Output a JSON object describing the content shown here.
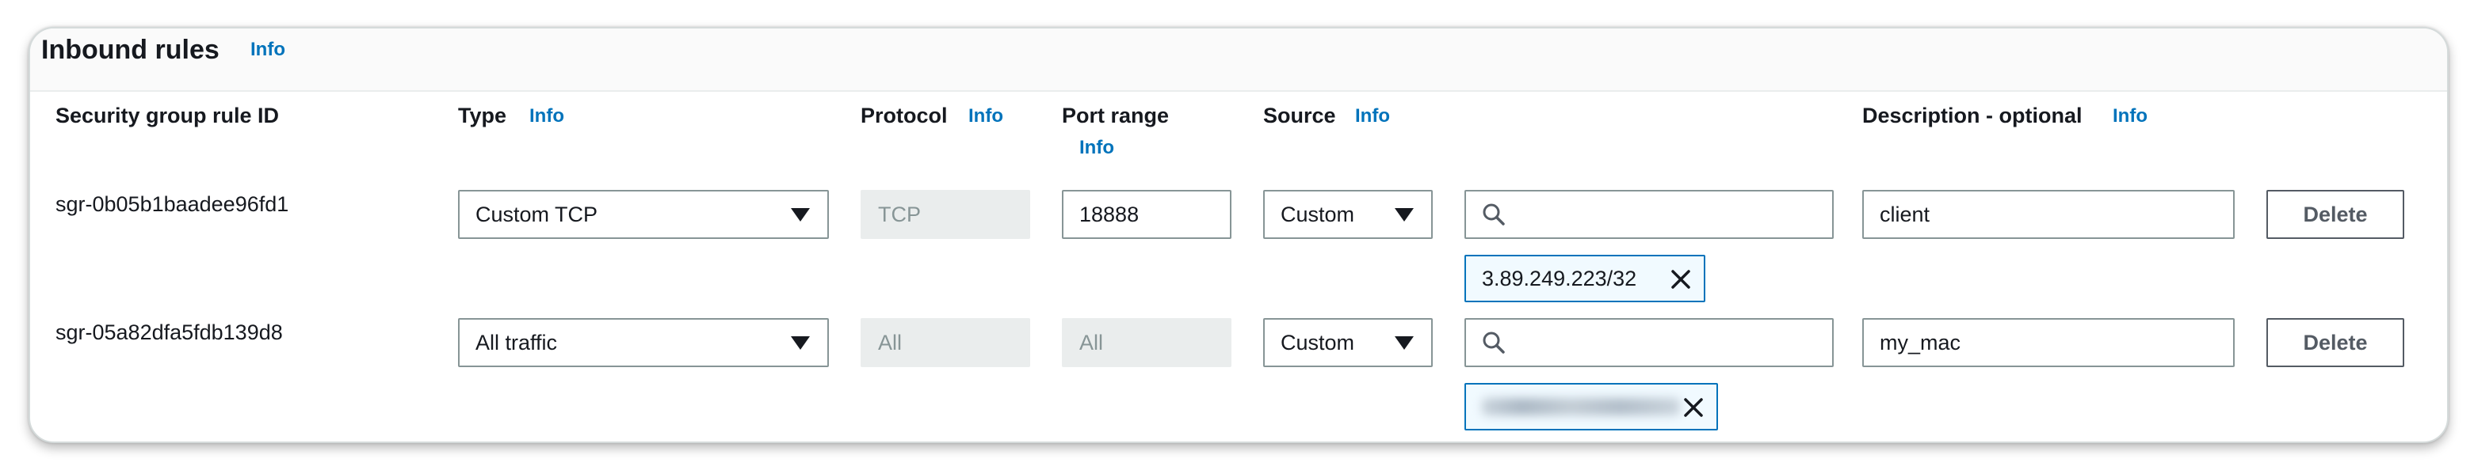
{
  "panel": {
    "title": "Inbound rules",
    "title_info": "Info"
  },
  "columns": {
    "rule_id": "Security group rule ID",
    "type": "Type",
    "type_info": "Info",
    "protocol": "Protocol",
    "protocol_info": "Info",
    "port_range": "Port range",
    "port_range_info": "Info",
    "source": "Source",
    "source_info": "Info",
    "description": "Description - optional",
    "description_info": "Info"
  },
  "rules": [
    {
      "rule_id": "sgr-0b05b1baadee96fd1",
      "type": "Custom TCP",
      "protocol": "TCP",
      "port_range": "18888",
      "source": "Custom",
      "source_search": "",
      "source_token": "3.89.249.223/32",
      "description": "client",
      "delete_label": "Delete"
    },
    {
      "rule_id": "sgr-05a82dfa5fdb139d8",
      "type": "All traffic",
      "protocol": "All",
      "port_range": "All",
      "source": "Custom",
      "source_search": "",
      "source_token": "",
      "description": "my_mac",
      "delete_label": "Delete"
    }
  ],
  "icons": {
    "search": "search-icon",
    "remove": "close-icon",
    "dropdown": "caret-down-icon"
  },
  "colors": {
    "info_link": "#0073bb",
    "token_border": "#0073bb",
    "token_bg": "#f1faff",
    "disabled_bg": "#eaeded",
    "field_border": "#879596"
  }
}
